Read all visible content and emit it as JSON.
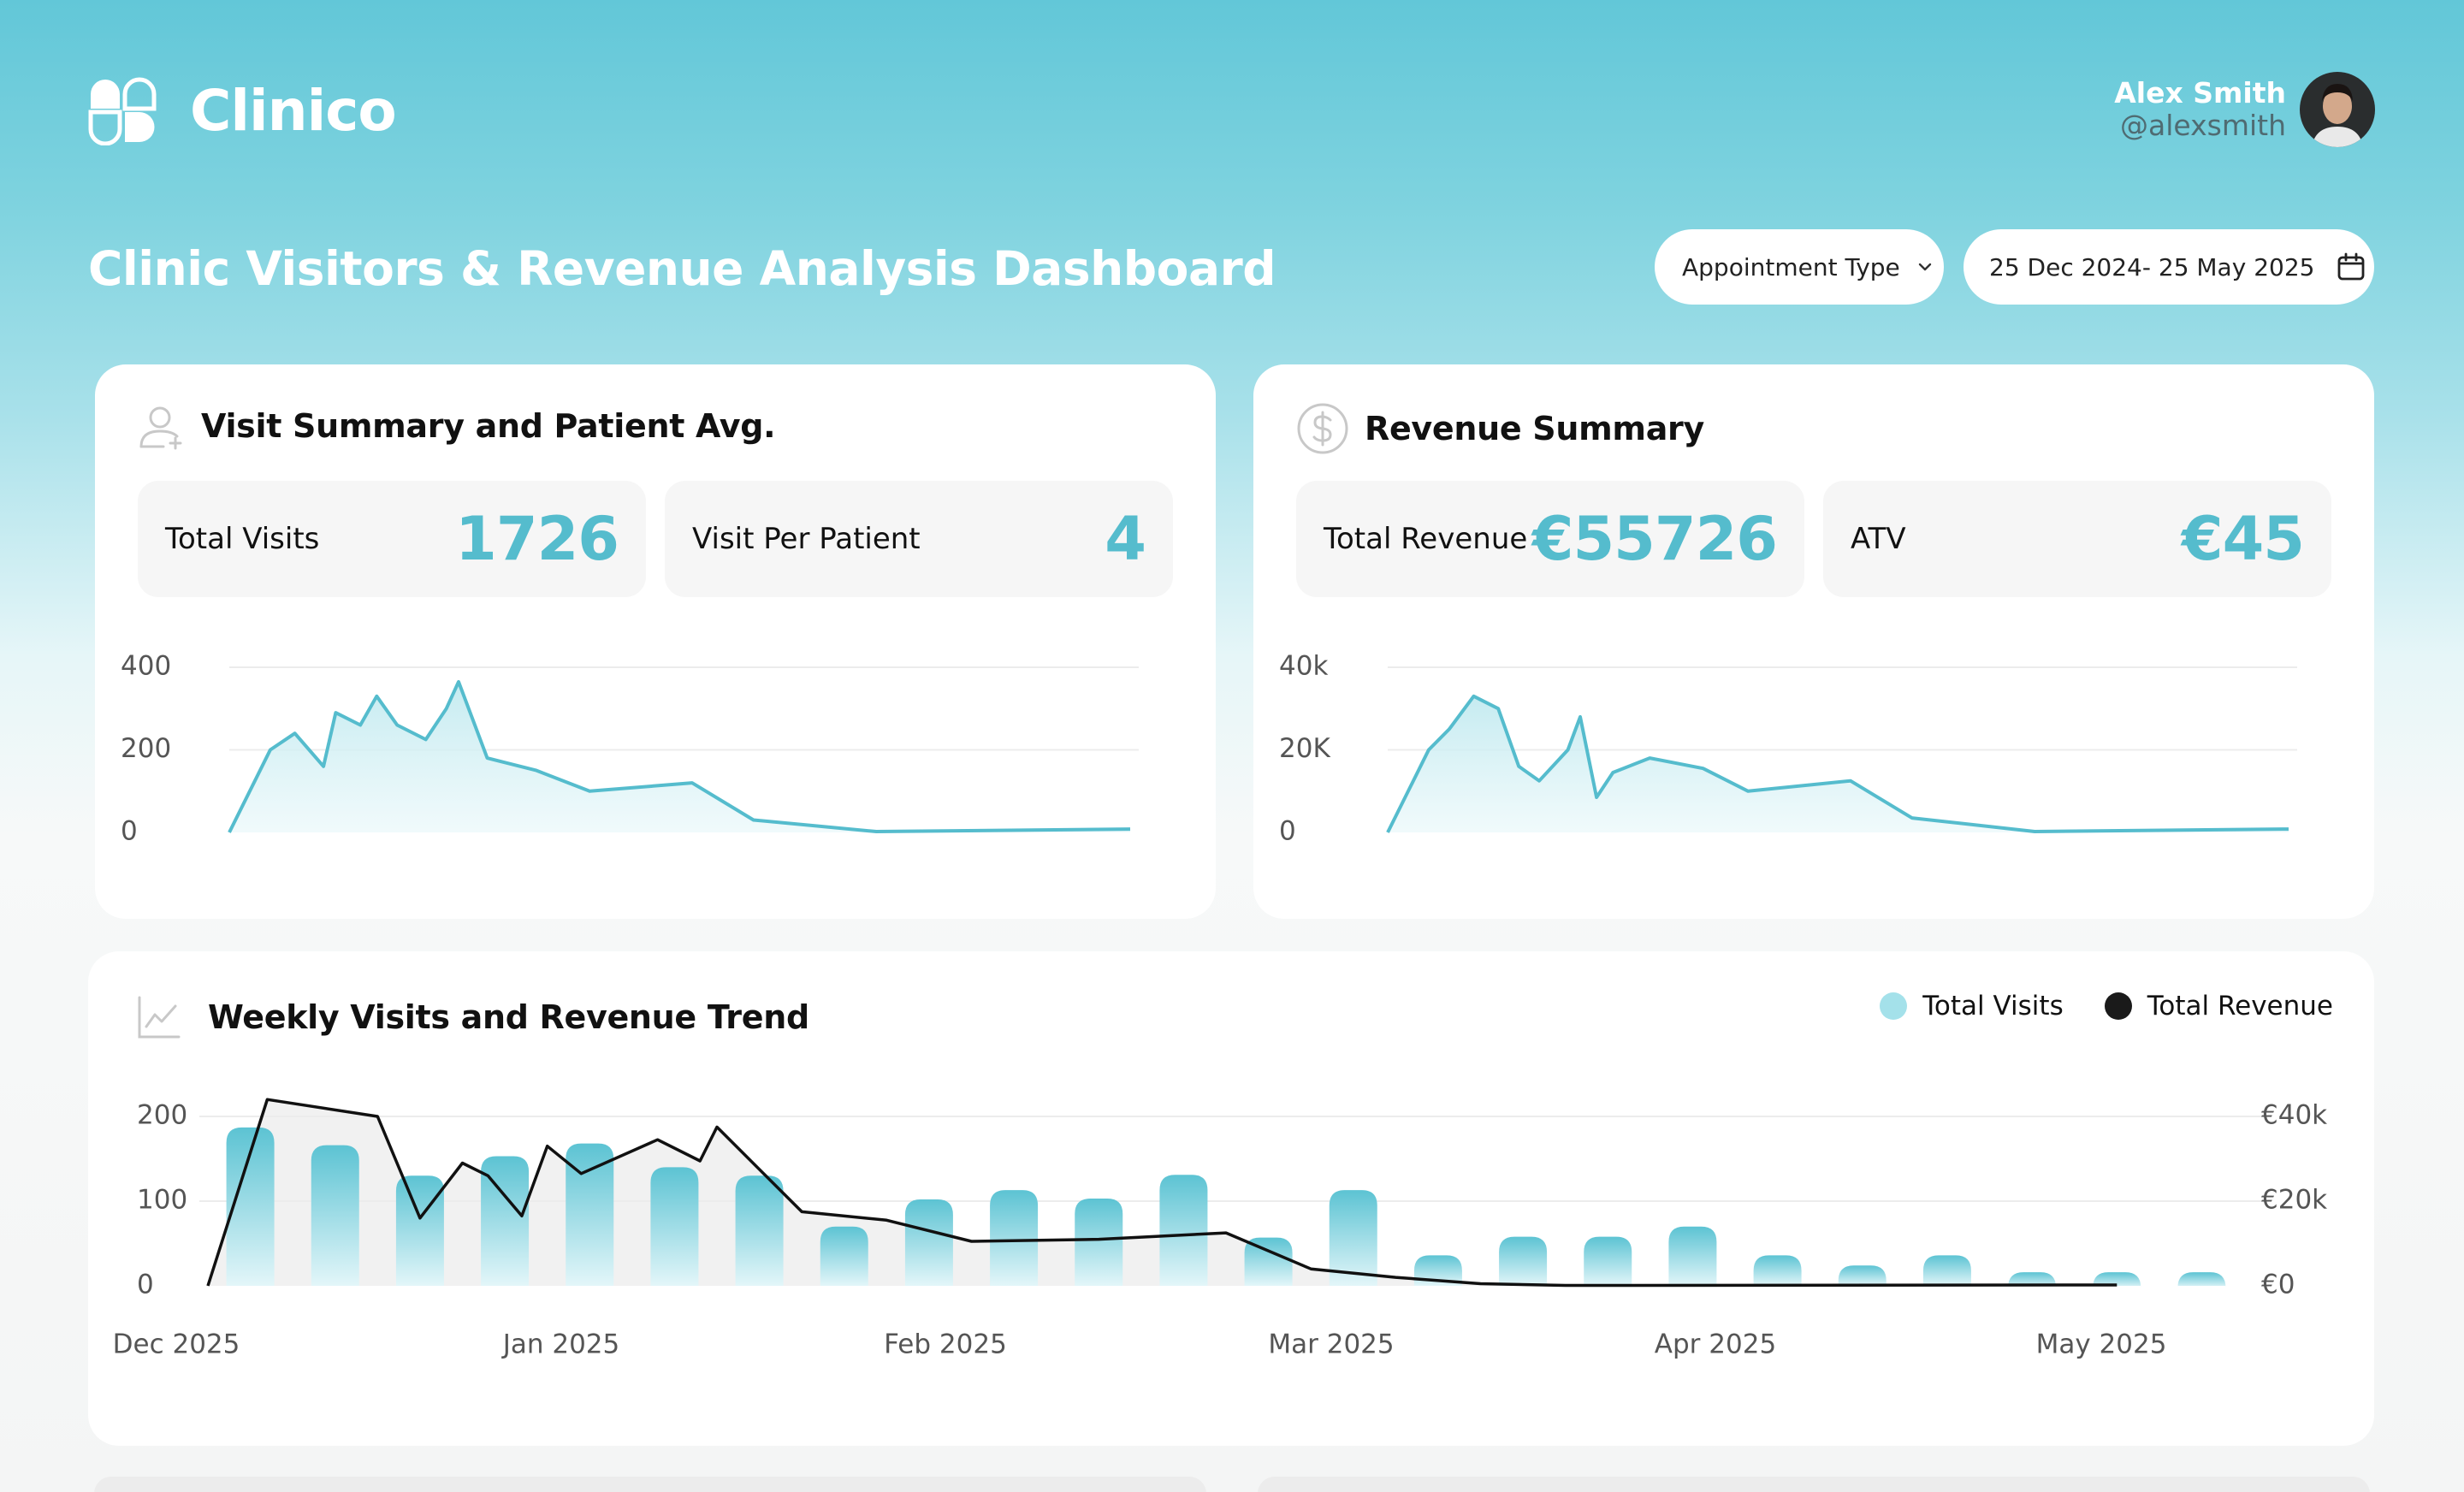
{
  "brand": {
    "name": "Clinico"
  },
  "user": {
    "name": "Alex Smith",
    "handle": "@alexsmith"
  },
  "page": {
    "title": "Clinic Visitors & Revenue Analysis Dashboard"
  },
  "filters": {
    "appointment_type_label": "Appointment Type",
    "date_range": "25 Dec 2024- 25 May 2025"
  },
  "visits_card": {
    "title": "Visit Summary and Patient Avg.",
    "kpis": [
      {
        "label": "Total Visits",
        "value": "1726"
      },
      {
        "label": "Visit Per Patient",
        "value": "4"
      }
    ]
  },
  "revenue_card": {
    "title": "Revenue Summary",
    "kpis": [
      {
        "label": "Total Revenue",
        "value": "€55726"
      },
      {
        "label": "ATV",
        "value": "€45"
      }
    ]
  },
  "trend_card": {
    "title": "Weekly Visits and Revenue Trend",
    "legend": [
      {
        "label": "Total Visits",
        "color": "#a4e1ea"
      },
      {
        "label": "Total Revenue",
        "color": "#1a1a1a"
      }
    ]
  },
  "colors": {
    "accent": "#55bccd",
    "accent_light": "#a4e1ea",
    "dark": "#111111"
  },
  "chart_data": [
    {
      "type": "area",
      "ylim": [
        0,
        400
      ],
      "y_ticks": [
        "0",
        "200",
        "400"
      ],
      "grid": true,
      "x": [
        0,
        1,
        1.6,
        2.3,
        2.6,
        3.2,
        3.6,
        4.1,
        4.8,
        5.3,
        5.6,
        6.3,
        7.5,
        8.8,
        11.3,
        12.8,
        15.8,
        22
      ],
      "values": [
        0,
        200,
        240,
        160,
        290,
        260,
        330,
        260,
        225,
        300,
        365,
        180,
        150,
        100,
        120,
        30,
        2,
        8
      ]
    },
    {
      "type": "area",
      "ylim": [
        0,
        40000
      ],
      "y_ticks": [
        "0",
        "20K",
        "40k"
      ],
      "grid": true,
      "x": [
        0,
        1,
        1.5,
        2.1,
        2.7,
        3.2,
        3.7,
        4.4,
        4.7,
        5.1,
        5.5,
        6.4,
        7.7,
        8.8,
        11.3,
        12.8,
        15.8,
        22
      ],
      "values": [
        0,
        20000,
        25000,
        33000,
        30000,
        16000,
        12500,
        20000,
        28000,
        8500,
        14500,
        18000,
        15500,
        10000,
        12500,
        3500,
        200,
        800
      ]
    },
    {
      "type": "bar",
      "x_ticks": [
        "Dec 2025",
        "Jan 2025",
        "Feb 2025",
        "Mar 2025",
        "Apr 2025",
        "May 2025"
      ],
      "y_ticks_left": [
        "0",
        "100",
        "200"
      ],
      "y_ticks_right": [
        "€0",
        "€20k",
        "€40k"
      ],
      "ylim": [
        0,
        200
      ],
      "y2lim": [
        0,
        40000
      ],
      "grid": true,
      "legend_position": "top-right",
      "series": [
        {
          "name": "Total Visits",
          "values": [
            187,
            166,
            130,
            153,
            168,
            140,
            130,
            70,
            102,
            113,
            103,
            131,
            57,
            113,
            36,
            58,
            58,
            70,
            36,
            24,
            36,
            16,
            16,
            16
          ]
        },
        {
          "name": "Total Revenue",
          "points": [
            [
              0,
              0
            ],
            [
              0.7,
              44000
            ],
            [
              2,
              40000
            ],
            [
              2.5,
              16000
            ],
            [
              3.0,
              29000
            ],
            [
              3.3,
              26000
            ],
            [
              3.7,
              16500
            ],
            [
              4.0,
              33000
            ],
            [
              4.4,
              26500
            ],
            [
              5.3,
              34500
            ],
            [
              5.8,
              29500
            ],
            [
              6.0,
              37500
            ],
            [
              7.0,
              17500
            ],
            [
              8.0,
              15500
            ],
            [
              9.0,
              10500
            ],
            [
              10.5,
              11000
            ],
            [
              12.0,
              12500
            ],
            [
              13.0,
              4000
            ],
            [
              14.0,
              2000
            ],
            [
              15.0,
              500
            ],
            [
              16.0,
              100
            ],
            [
              22.5,
              200
            ]
          ]
        }
      ]
    }
  ]
}
